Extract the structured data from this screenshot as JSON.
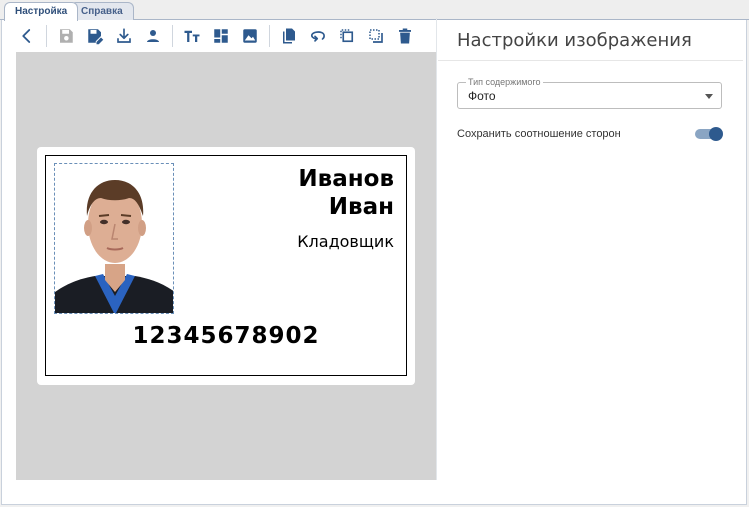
{
  "tabs": [
    {
      "label": "Настройка",
      "active": true
    },
    {
      "label": "Справка",
      "active": false
    }
  ],
  "toolbar": {
    "icons": [
      "back-icon",
      "save-icon",
      "save-as-icon",
      "download-icon",
      "person-icon",
      "text-icon",
      "layout-icon",
      "image-icon",
      "copy-icon",
      "rotate-icon",
      "bring-front-icon",
      "send-back-icon",
      "delete-icon"
    ]
  },
  "card": {
    "last_name": "Иванов",
    "first_name": "Иван",
    "position": "Кладовщик",
    "number": "12345678902"
  },
  "settings": {
    "title": "Настройки изображения",
    "content_type_label": "Тип содержимого",
    "content_type_value": "Фото",
    "keep_ratio_label": "Сохранить соотношение сторон",
    "keep_ratio_on": true
  },
  "colors": {
    "icon": "#2e5a8e",
    "icon_disabled": "#b0b0b0",
    "canvas": "#d3d3d3",
    "toggle": "#2e5a8e"
  }
}
